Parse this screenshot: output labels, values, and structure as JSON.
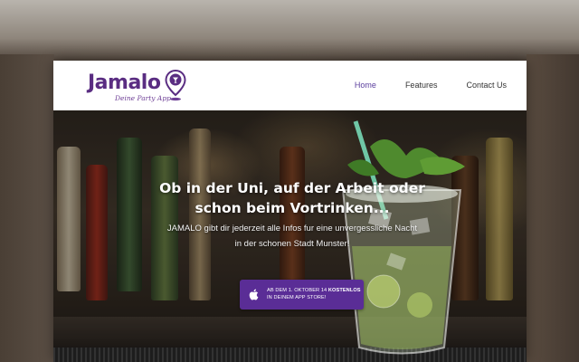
{
  "brand": {
    "name": "Jamalo",
    "tagline": "Deine Party App"
  },
  "nav": {
    "items": [
      {
        "label": "Home",
        "active": true
      },
      {
        "label": "Features",
        "active": false
      },
      {
        "label": "Contact Us",
        "active": false
      }
    ]
  },
  "hero": {
    "headline_line1": "Ob in der Uni, auf der Arbeit oder",
    "headline_line2": "schon beim Vortrinken...",
    "sub_line1": "JAMALO gibt dir jederzeit alle Infos fur eine unvergessliche Nacht",
    "sub_line2": "in der schonen Stadt Munster!",
    "cta": {
      "line1_prefix": "AB DEM 1. OKTOBER 14 ",
      "line1_bold": "KOSTENLOS",
      "line2": "IN DEINEM APP STORE!",
      "icon": "apple-icon"
    }
  },
  "colors": {
    "brand_purple": "#5a2d82",
    "cta_purple": "#5a2d96",
    "nav_active": "#5b3f9e"
  }
}
